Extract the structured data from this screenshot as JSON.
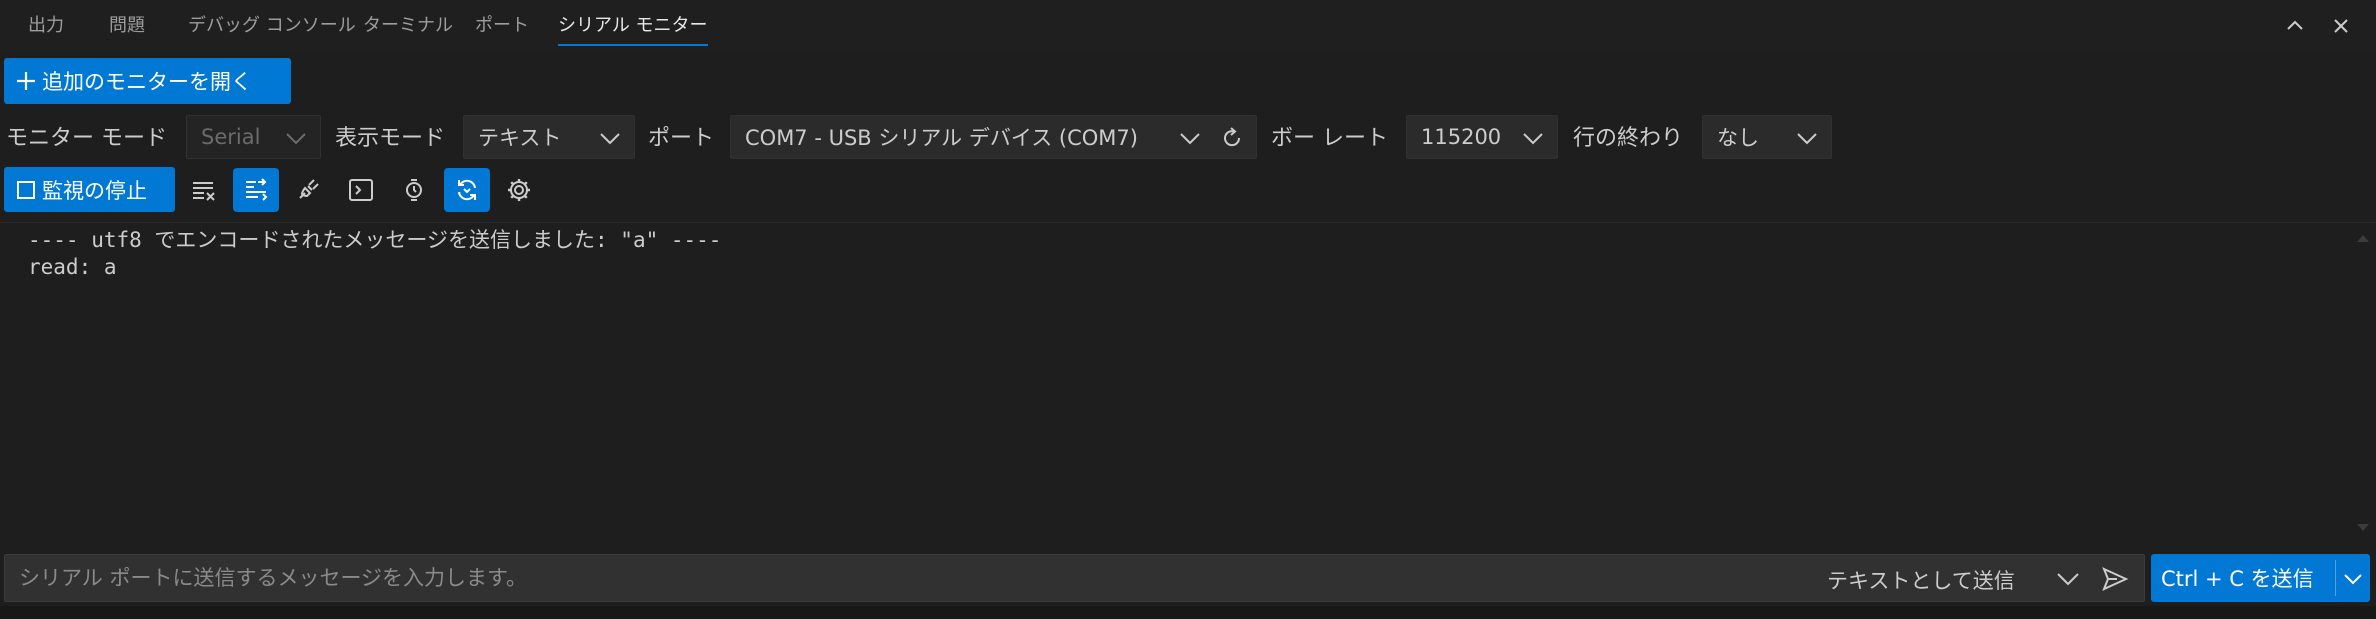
{
  "tabs": [
    {
      "label": "出力"
    },
    {
      "label": "問題"
    },
    {
      "label": "デバッグ コンソール"
    },
    {
      "label": "ターミナル"
    },
    {
      "label": "ポート"
    },
    {
      "label": "シリアル モニター"
    }
  ],
  "toolbar_top": {
    "open_monitor_label": "追加のモニターを開く"
  },
  "settings": {
    "monitor_mode_label": "モニター モード",
    "monitor_mode_value": "Serial",
    "display_mode_label": "表示モード",
    "display_mode_value": "テキスト",
    "port_label": "ポート",
    "port_value": "COM7 - USB シリアル デバイス (COM7)",
    "baud_label": "ボー レート",
    "baud_value": "115200",
    "line_ending_label": "行の終わり",
    "line_ending_value": "なし"
  },
  "actions": {
    "stop_label": "監視の停止"
  },
  "output": {
    "lines": [
      "---- utf8 でエンコードされたメッセージを送信しました: \"a\" ----",
      "read: a"
    ]
  },
  "input": {
    "placeholder": "シリアル ポートに送信するメッセージを入力します。",
    "value": "",
    "send_mode_label": "テキストとして送信",
    "ctrl_c_label": "Ctrl + C を送信"
  },
  "colors": {
    "accent": "#0078d4",
    "background": "#1e1e1e"
  }
}
